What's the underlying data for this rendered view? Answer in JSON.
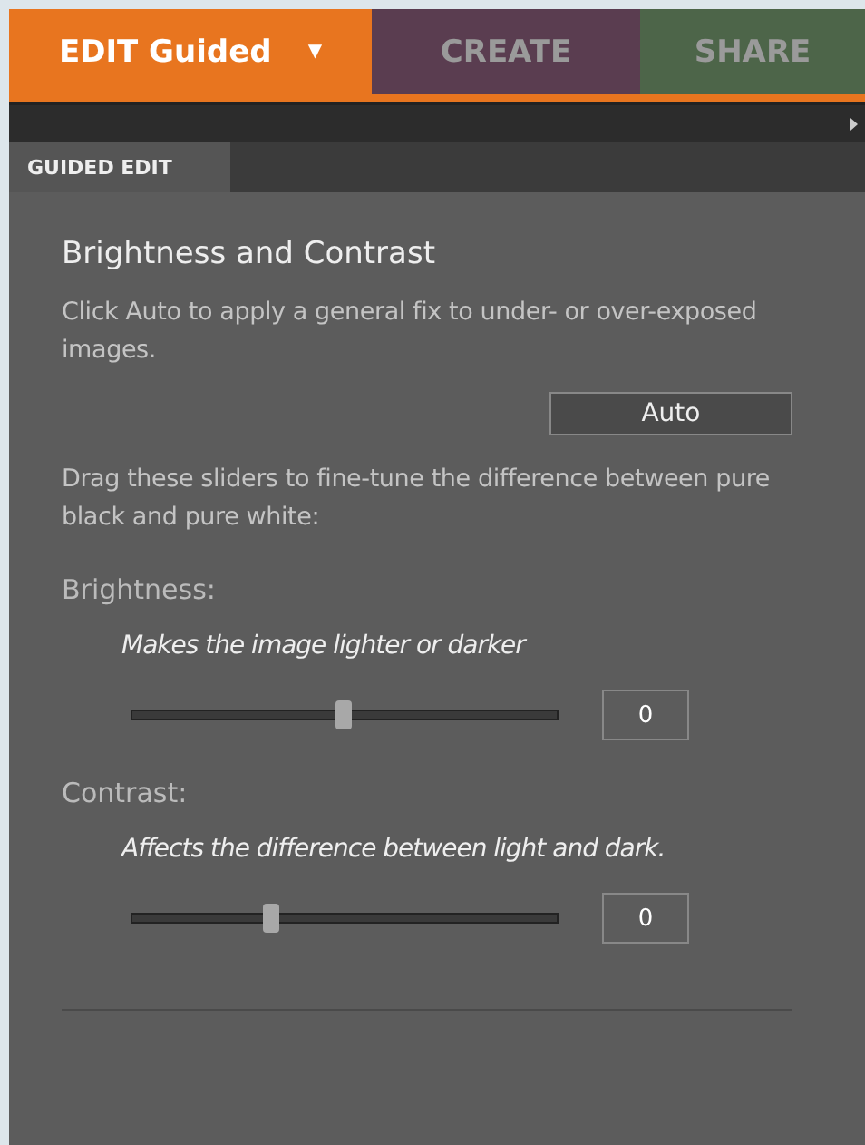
{
  "mode_tabs": [
    {
      "label": "EDIT Guided",
      "selected": true,
      "color": "#e8751f",
      "dropdown": "▼"
    },
    {
      "label": "CREATE",
      "selected": false,
      "color": "#5a3d50"
    },
    {
      "label": "SHARE",
      "selected": false,
      "color": "#4d6549"
    }
  ],
  "panel_tab": {
    "label": "GUIDED EDIT"
  },
  "title": "Brightness and Contrast",
  "auto_text": "Click Auto to apply a general fix to under- or over-exposed images.",
  "auto_button": "Auto",
  "drag_text": "Drag these sliders to fine-tune the difference between pure black and pure white:",
  "sliders": [
    {
      "label": "Brightness:",
      "hint": "Makes the image lighter or darker",
      "level": 0.5,
      "value": "0"
    },
    {
      "label": "Contrast:",
      "hint": "Affects the difference between light and dark.",
      "level": 0.33,
      "value": "0"
    }
  ]
}
